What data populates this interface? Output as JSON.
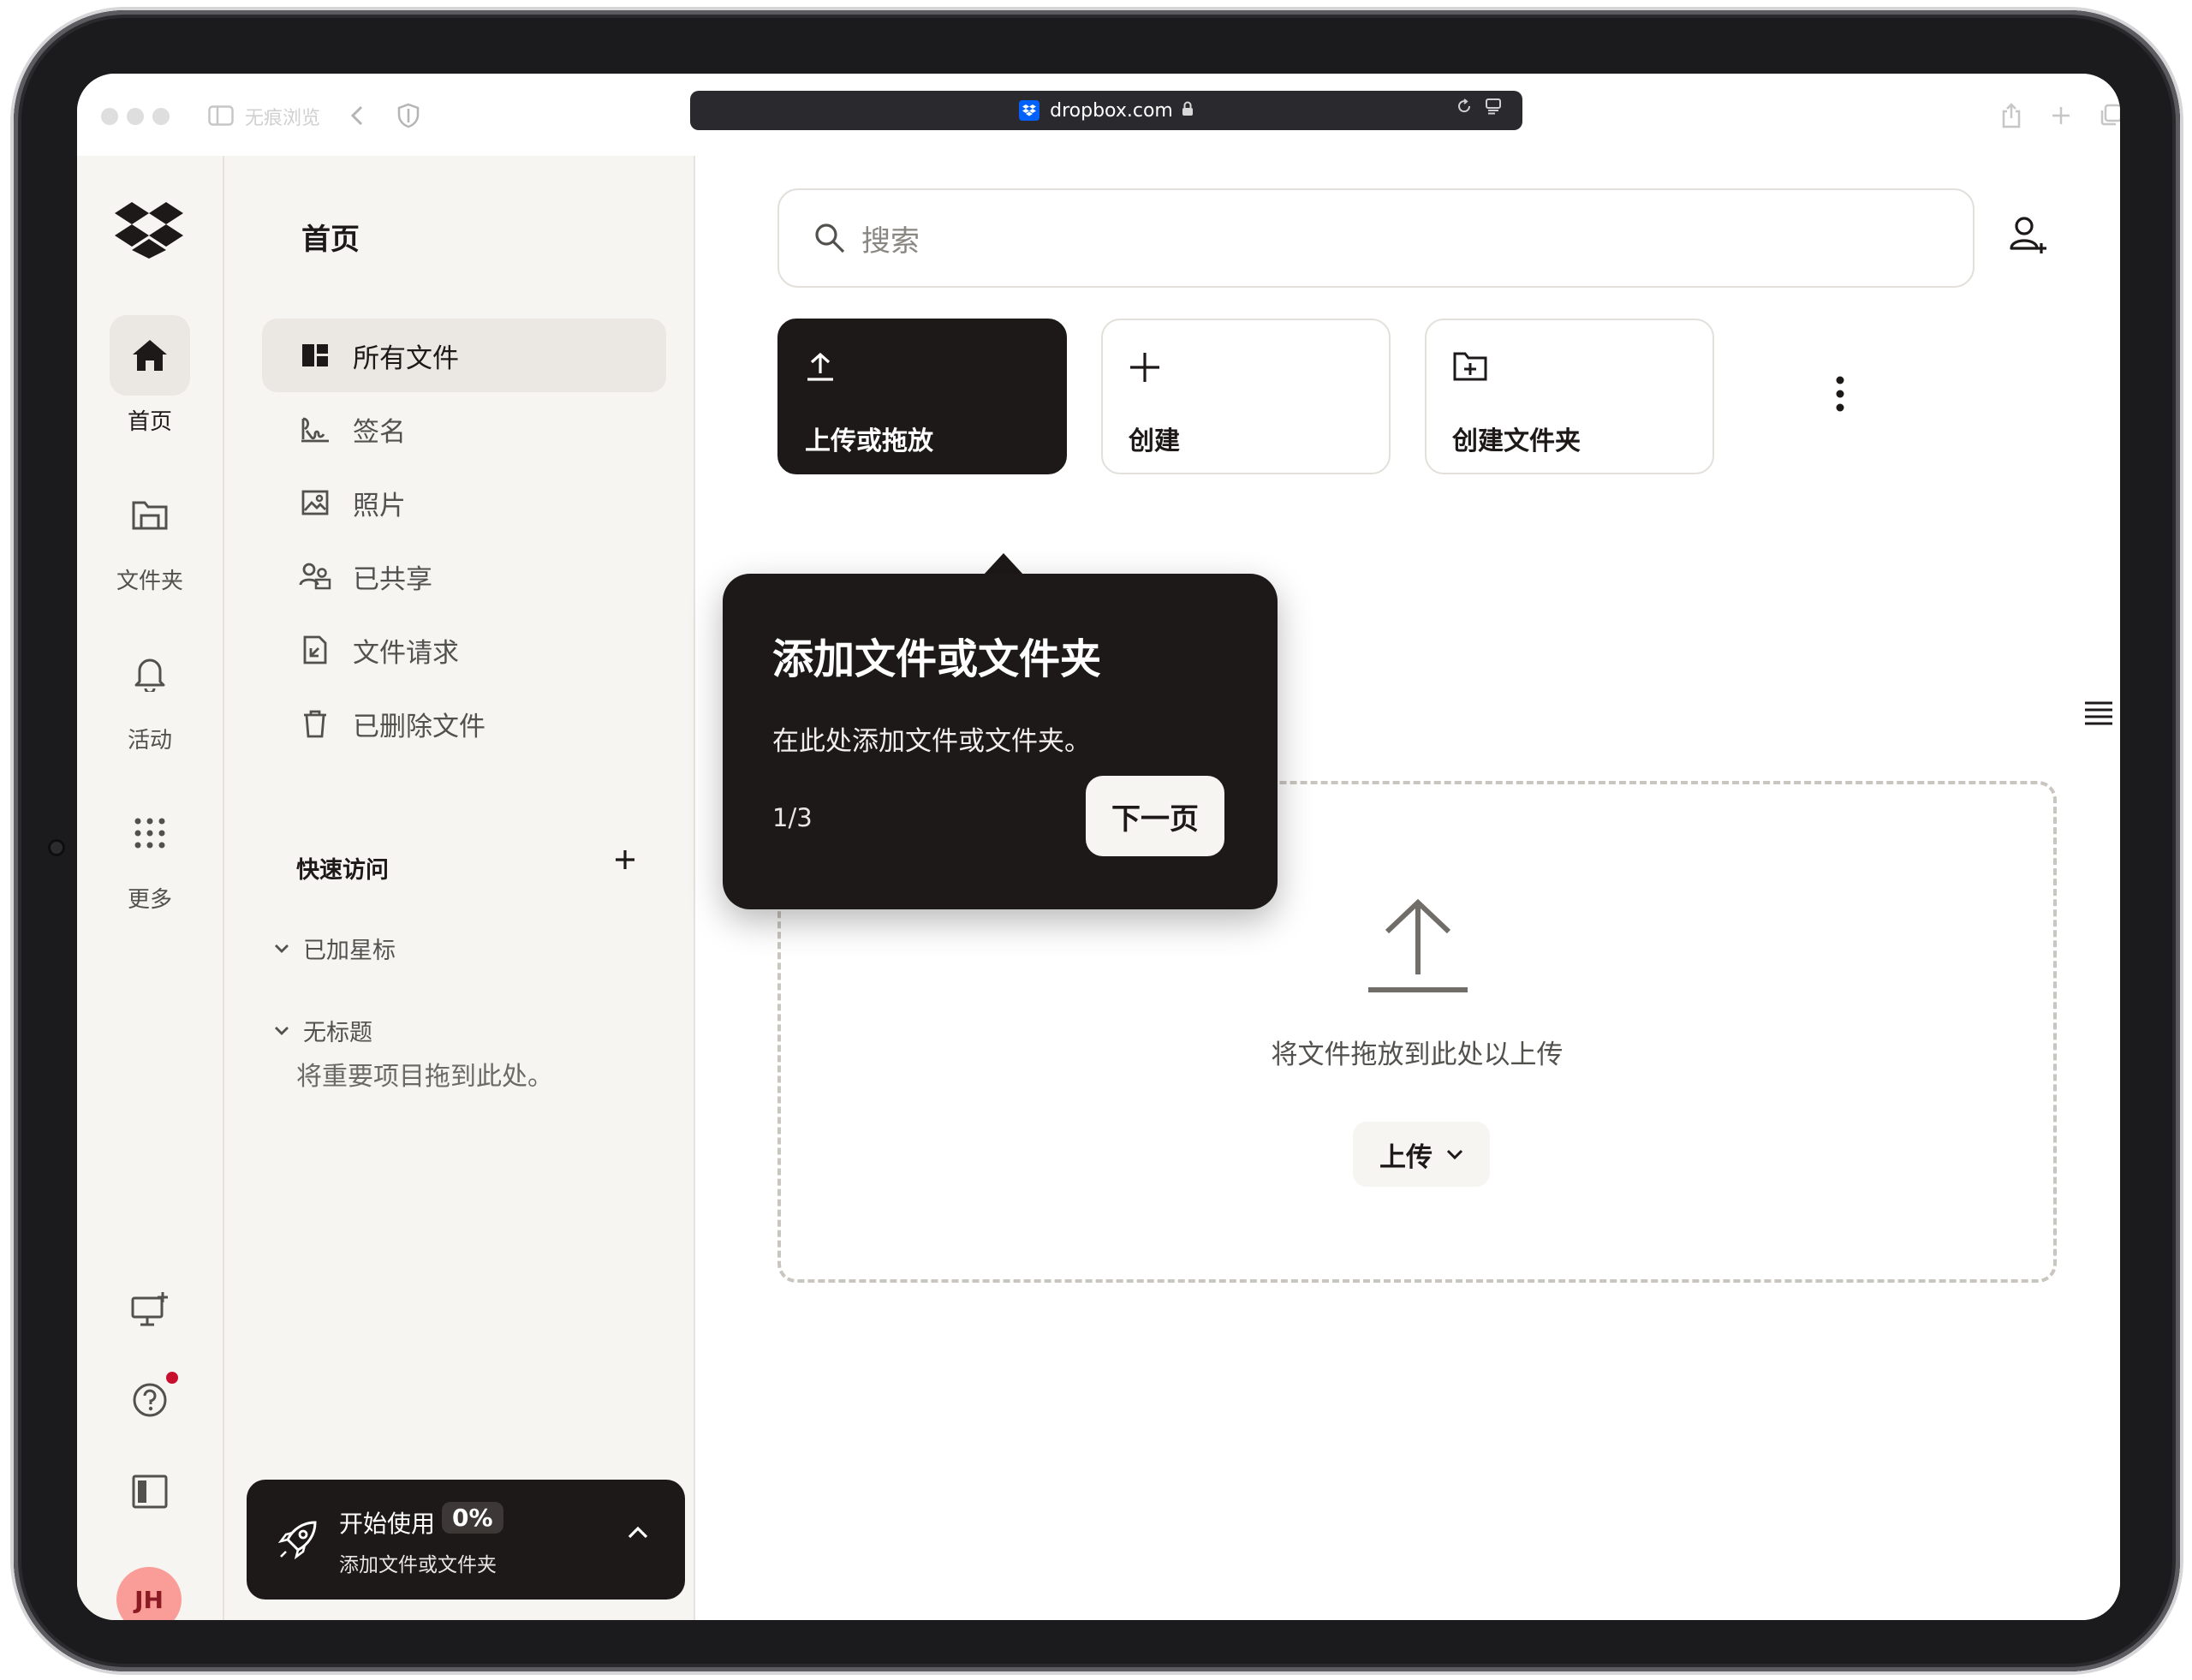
{
  "browser": {
    "private_label": "无痕浏览",
    "url": "dropbox.com"
  },
  "rail": {
    "items": [
      {
        "label": "首页",
        "icon": "home-icon"
      },
      {
        "label": "文件夹",
        "icon": "folder-icon"
      },
      {
        "label": "活动",
        "icon": "bell-icon"
      },
      {
        "label": "更多",
        "icon": "grid-icon"
      }
    ],
    "avatar_initials": "JH"
  },
  "nav": {
    "title": "首页",
    "items": [
      {
        "label": "所有文件",
        "icon": "all-files-icon"
      },
      {
        "label": "签名",
        "icon": "signature-icon"
      },
      {
        "label": "照片",
        "icon": "photo-icon"
      },
      {
        "label": "已共享",
        "icon": "shared-icon"
      },
      {
        "label": "文件请求",
        "icon": "file-request-icon"
      },
      {
        "label": "已删除文件",
        "icon": "trash-icon"
      }
    ],
    "quick_access": {
      "title": "快速访问",
      "groups": [
        "已加星标",
        "无标题"
      ],
      "hint": "将重要项目拖到此处。"
    },
    "getting_started": {
      "title": "开始使用",
      "progress": "0%",
      "subtitle": "添加文件或文件夹"
    }
  },
  "main": {
    "search_placeholder": "搜索",
    "actions": [
      {
        "label": "上传或拖放",
        "icon": "upload-icon",
        "primary": true
      },
      {
        "label": "创建",
        "icon": "plus-icon",
        "primary": false
      },
      {
        "label": "创建文件夹",
        "icon": "new-folder-icon",
        "primary": false
      }
    ],
    "dropzone": {
      "text": "将文件拖放到此处以上传",
      "upload_label": "上传"
    }
  },
  "popover": {
    "title": "添加文件或文件夹",
    "body": "在此处添加文件或文件夹。",
    "step": "1/3",
    "next_label": "下一页"
  },
  "colors": {
    "dark": "#1e1919",
    "panel_bg": "#f7f5f2",
    "dropbox_blue": "#0061fe",
    "avatar_bg": "#fa9c97",
    "notification": "#c8102e"
  }
}
